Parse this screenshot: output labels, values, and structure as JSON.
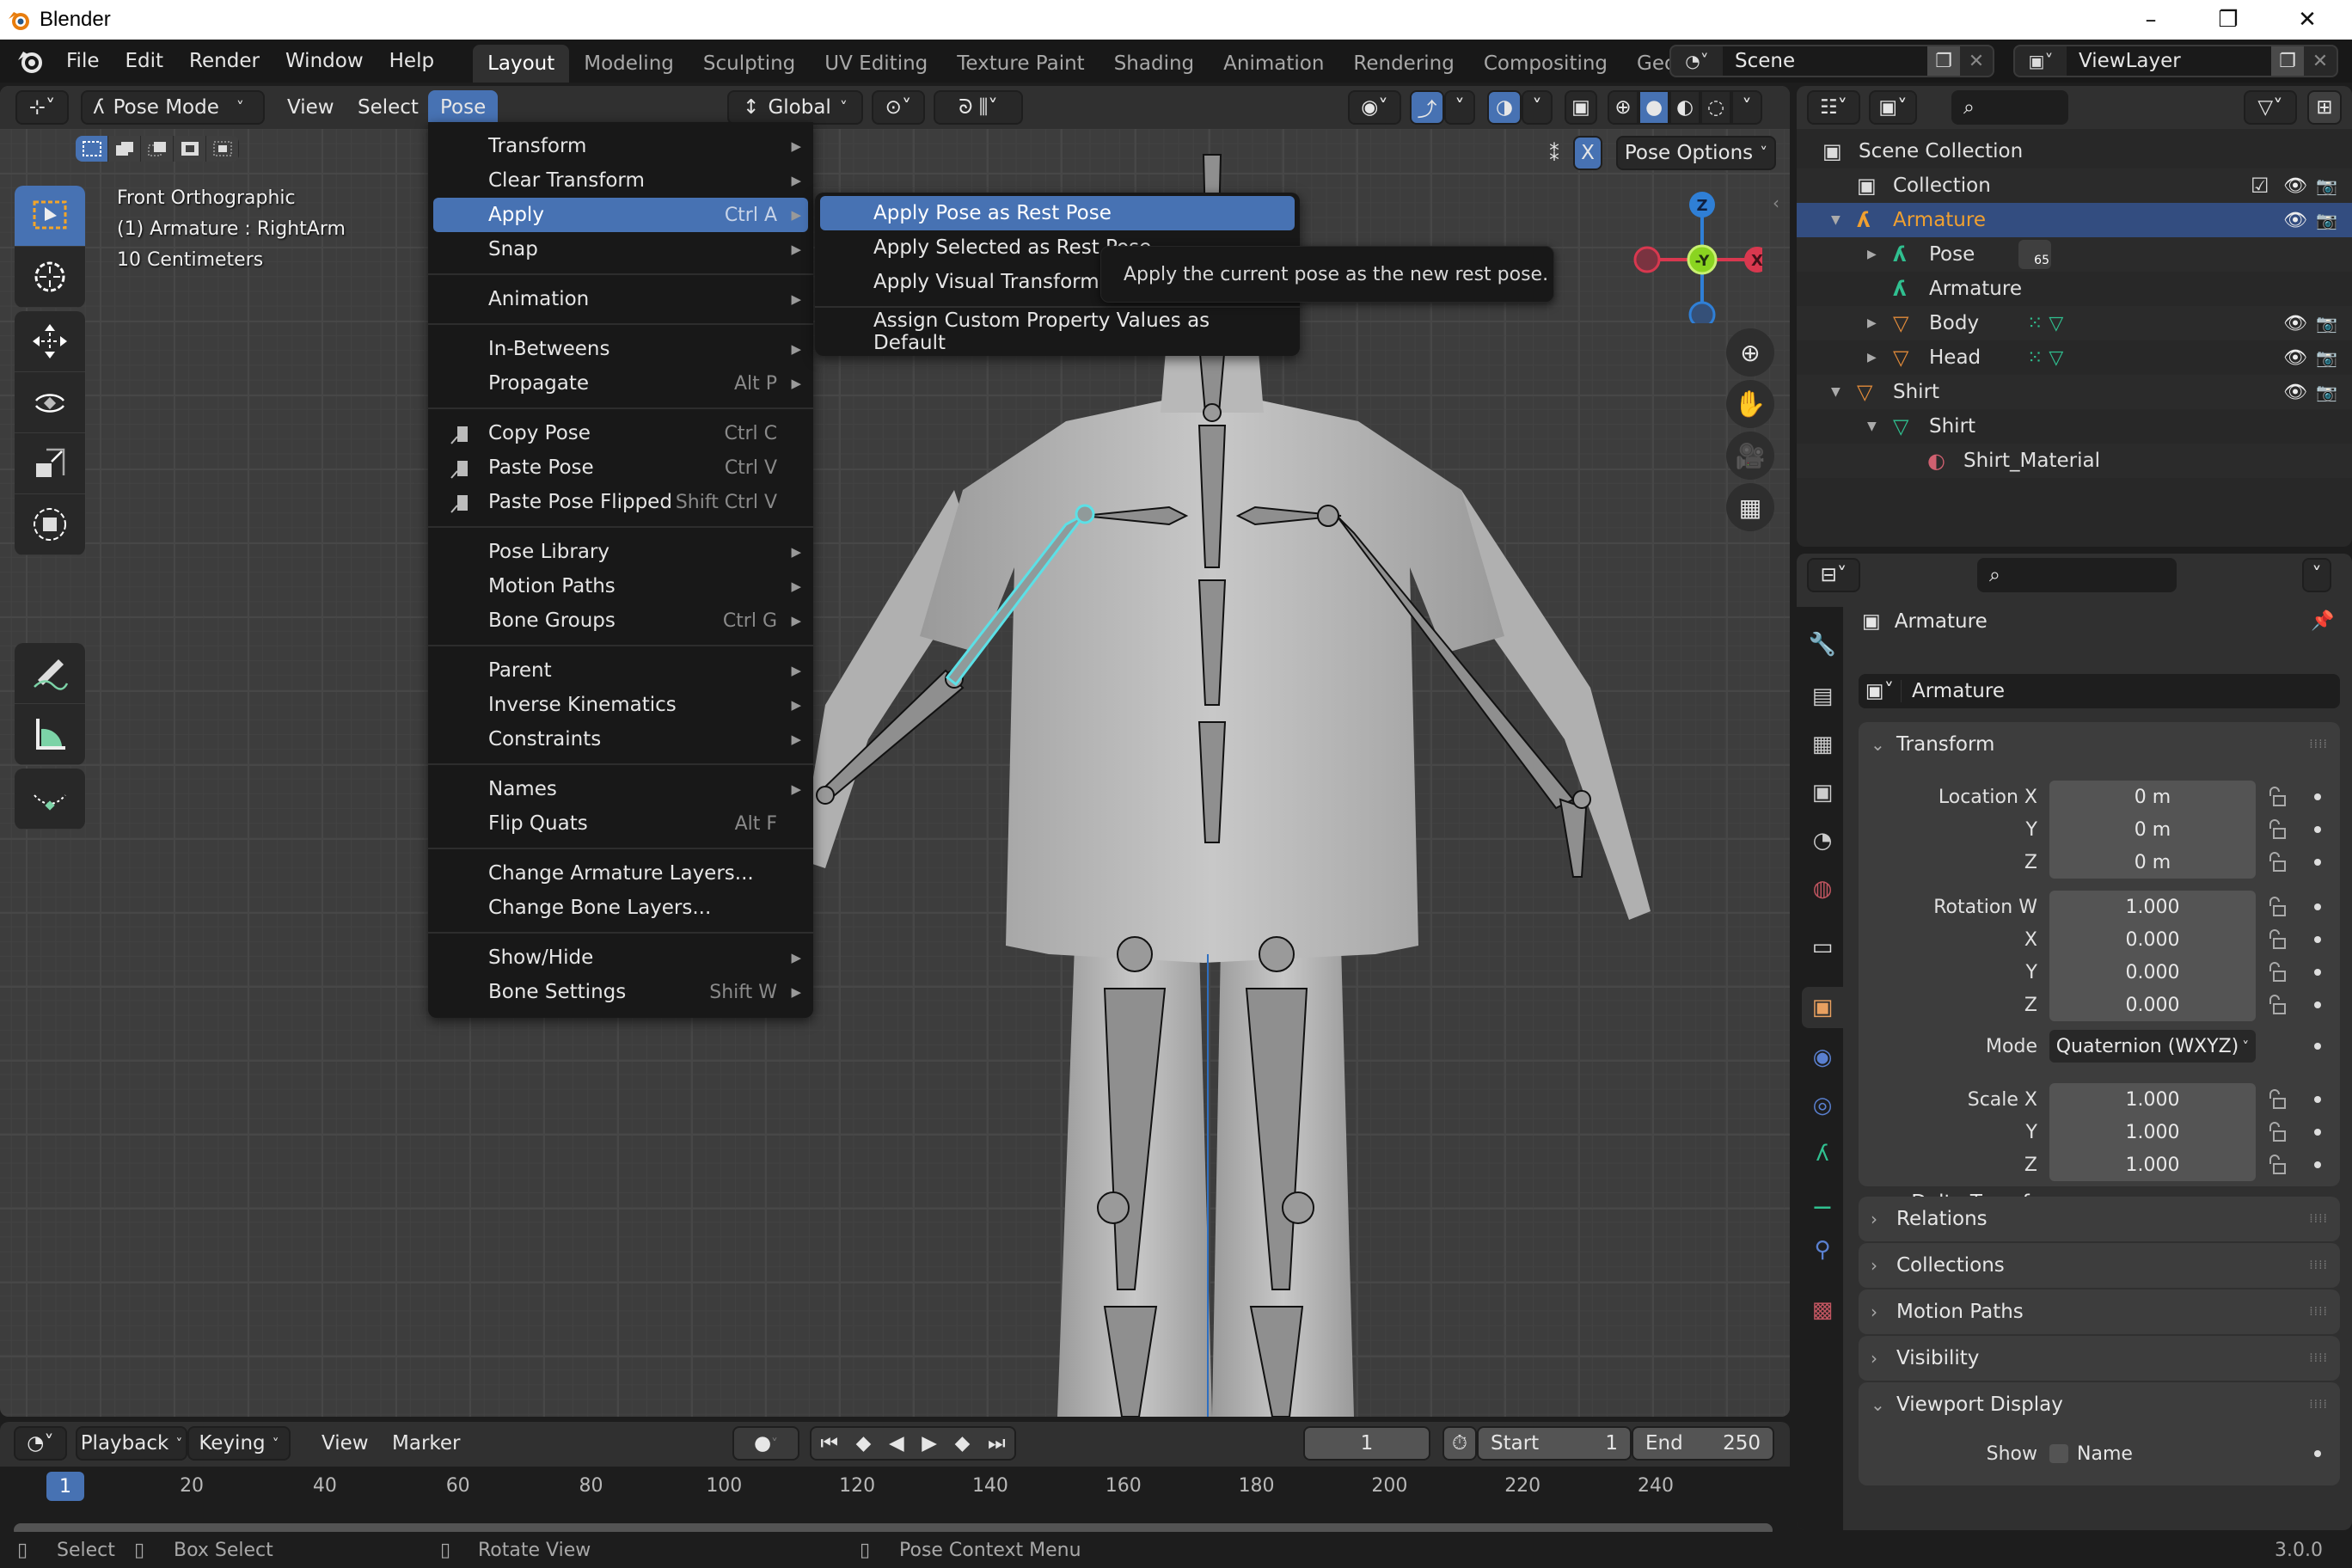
{
  "window": {
    "title": "Blender",
    "controls": {
      "minimize": "–",
      "restore": "❐",
      "close": "✕"
    }
  },
  "topbar": {
    "menus": [
      "File",
      "Edit",
      "Render",
      "Window",
      "Help"
    ],
    "workspaces": [
      "Layout",
      "Modeling",
      "Sculpting",
      "UV Editing",
      "Texture Paint",
      "Shading",
      "Animation",
      "Rendering",
      "Compositing",
      "Geome"
    ],
    "active_workspace": "Layout",
    "scene": "Scene",
    "view_layer": "ViewLayer"
  },
  "viewport_header": {
    "mode": "Pose Mode",
    "menus": [
      "View",
      "Select",
      "Pose"
    ],
    "active_menu": "Pose",
    "orientation": "Global",
    "pose_options": "Pose Options",
    "mirror_x": "X"
  },
  "viewport_info": {
    "view": "Front Orthographic",
    "object": "(1) Armature : RightArm",
    "scale": "10 Centimeters"
  },
  "gizmo": {
    "z": "Z",
    "y": "-Y",
    "x": "X"
  },
  "pose_menu": {
    "items": [
      {
        "label": "Transform",
        "shortcut": "",
        "submenu": true
      },
      {
        "label": "Clear Transform",
        "shortcut": "",
        "submenu": true
      },
      {
        "label": "Apply",
        "shortcut": "Ctrl A",
        "submenu": true,
        "highlighted": true
      },
      {
        "label": "Snap",
        "shortcut": "",
        "submenu": true
      },
      {
        "sep": true
      },
      {
        "label": "Animation",
        "shortcut": "",
        "submenu": true
      },
      {
        "sep": true
      },
      {
        "label": "In-Betweens",
        "shortcut": "",
        "submenu": true
      },
      {
        "label": "Propagate",
        "shortcut": "Alt P",
        "submenu": true
      },
      {
        "sep": true
      },
      {
        "label": "Copy Pose",
        "shortcut": "Ctrl C",
        "icon": "copy-pose-icon"
      },
      {
        "label": "Paste Pose",
        "shortcut": "Ctrl V",
        "icon": "paste-pose-icon"
      },
      {
        "label": "Paste Pose Flipped",
        "shortcut": "Shift Ctrl V",
        "icon": "paste-flipped-icon"
      },
      {
        "sep": true
      },
      {
        "label": "Pose Library",
        "shortcut": "",
        "submenu": true
      },
      {
        "label": "Motion Paths",
        "shortcut": "",
        "submenu": true
      },
      {
        "label": "Bone Groups",
        "shortcut": "Ctrl G",
        "submenu": true
      },
      {
        "sep": true
      },
      {
        "label": "Parent",
        "shortcut": "",
        "submenu": true
      },
      {
        "label": "Inverse Kinematics",
        "shortcut": "",
        "submenu": true
      },
      {
        "label": "Constraints",
        "shortcut": "",
        "submenu": true
      },
      {
        "sep": true
      },
      {
        "label": "Names",
        "shortcut": "",
        "submenu": true
      },
      {
        "label": "Flip Quats",
        "shortcut": "Alt F"
      },
      {
        "sep": true
      },
      {
        "label": "Change Armature Layers...",
        "shortcut": ""
      },
      {
        "label": "Change Bone Layers...",
        "shortcut": ""
      },
      {
        "sep": true
      },
      {
        "label": "Show/Hide",
        "shortcut": "",
        "submenu": true
      },
      {
        "label": "Bone Settings",
        "shortcut": "Shift W",
        "submenu": true
      }
    ]
  },
  "apply_submenu": {
    "items": [
      {
        "label": "Apply Pose as Rest Pose",
        "highlighted": true
      },
      {
        "label": "Apply Selected as Rest Pose"
      },
      {
        "label": "Apply Visual Transform to Pose"
      },
      {
        "sep": true
      },
      {
        "label": "Assign Custom Property Values as Default"
      }
    ]
  },
  "tooltip": "Apply the current pose as the new rest pose.",
  "timeline": {
    "menus": [
      "Playback",
      "Keying",
      "View",
      "Marker"
    ],
    "current_frame": "1",
    "start_label": "Start",
    "start": "1",
    "end_label": "End",
    "end": "250",
    "ticks": [
      "20",
      "40",
      "60",
      "80",
      "100",
      "120",
      "140",
      "160",
      "180",
      "200",
      "220",
      "240"
    ],
    "frame_indicator": "1"
  },
  "statusbar": {
    "select": "Select",
    "box_select": "Box Select",
    "rotate": "Rotate View",
    "context": "Pose Context Menu",
    "version": "3.0.0"
  },
  "outliner": {
    "rows": [
      {
        "label": "Scene Collection",
        "icon": "scene-collection-icon"
      },
      {
        "label": "Collection",
        "icon": "collection-icon",
        "checkbox": true,
        "eye": true,
        "cam": true
      },
      {
        "label": "Armature",
        "icon": "armature-object-icon",
        "selected": true,
        "eye": true,
        "cam": true
      },
      {
        "label": "Pose",
        "icon": "pose-icon",
        "badge": "65"
      },
      {
        "label": "Armature",
        "icon": "armature-data-icon"
      },
      {
        "label": "Body",
        "icon": "mesh-object-icon",
        "eye": true,
        "cam": true
      },
      {
        "label": "Head",
        "icon": "mesh-object-icon",
        "eye": true,
        "cam": true
      },
      {
        "label": "Shirt",
        "icon": "mesh-object-icon",
        "eye": true,
        "cam": true
      },
      {
        "label": "Shirt",
        "icon": "mesh-data-icon"
      },
      {
        "label": "Shirt_Material",
        "icon": "material-icon"
      }
    ]
  },
  "properties": {
    "object_name": "Armature",
    "datablock_name": "Armature",
    "transform_title": "Transform",
    "location": {
      "label_x": "Location X",
      "x": "0 m",
      "y": "0 m",
      "z": "0 m"
    },
    "rotation": {
      "label_w": "Rotation W",
      "w": "1.000",
      "x": "0.000",
      "y": "0.000",
      "z": "0.000"
    },
    "mode_label": "Mode",
    "mode": "Quaternion (WXYZ)",
    "scale": {
      "label_x": "Scale X",
      "x": "1.000",
      "y": "1.000",
      "z": "1.000"
    },
    "axis_labels": {
      "x": "X",
      "y": "Y",
      "z": "Z"
    },
    "delta_transform": "Delta Transform",
    "panels": [
      "Relations",
      "Collections",
      "Motion Paths",
      "Visibility"
    ],
    "viewport_display": "Viewport Display",
    "show_label": "Show",
    "name_label": "Name"
  },
  "colors": {
    "accent": "#4772b3",
    "selected_row": "#334d80",
    "armature_orange": "#f0a030",
    "gizmo_x": "#d8384f",
    "gizmo_y": "#8ad420",
    "gizmo_z": "#2f7fd6",
    "bone_selected": "#5ce0e6"
  }
}
